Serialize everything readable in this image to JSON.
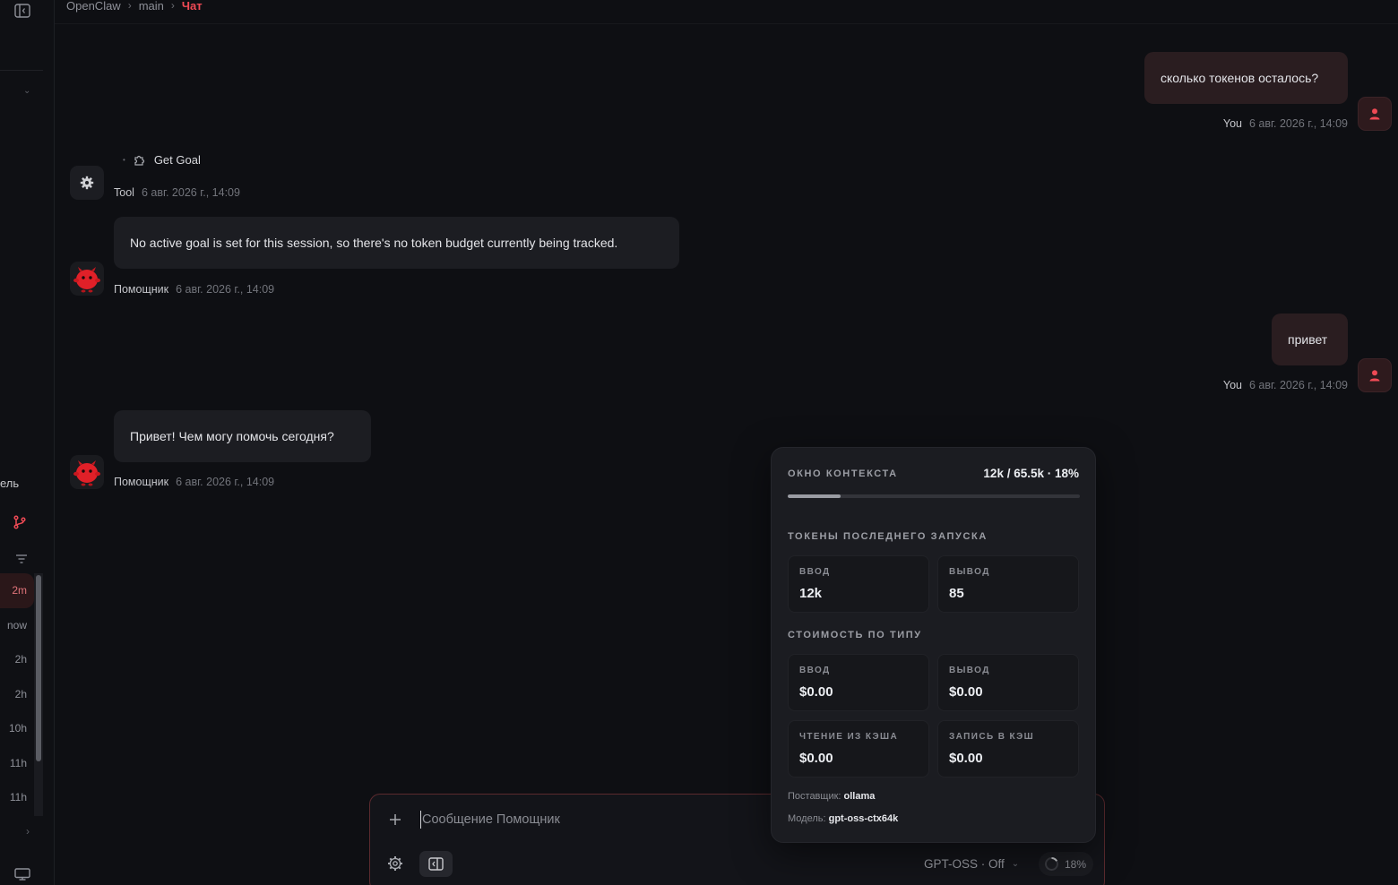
{
  "breadcrumb": {
    "items": [
      "OpenClaw",
      "main"
    ],
    "current": "Чат"
  },
  "rail": {
    "cut_label": "ель",
    "session_times": [
      "2m",
      "now",
      "2h",
      "2h",
      "10h",
      "11h",
      "11h"
    ]
  },
  "messages": {
    "user1": {
      "text": "сколько токенов осталось?",
      "author": "You",
      "time": "6 авг. 2026 г., 14:09"
    },
    "tool": {
      "call": "Get Goal",
      "author": "Tool",
      "time": "6 авг. 2026 г., 14:09"
    },
    "bot1": {
      "text": "No active goal is set for this session, so there's no token budget currently being tracked.",
      "author": "Помощник",
      "time": "6 авг. 2026 г., 14:09"
    },
    "user2": {
      "text": "привет",
      "author": "You",
      "time": "6 авг. 2026 г., 14:09"
    },
    "bot2": {
      "text": "Привет! Чем могу помочь сегодня?",
      "author": "Помощник",
      "time": "6 авг. 2026 г., 14:09"
    }
  },
  "composer": {
    "placeholder": "Сообщение Помощник",
    "model_label": "GPT-OSS · Off",
    "context_percent": "18%"
  },
  "context_popover": {
    "window_title": "ОКНО КОНТЕКСТА",
    "window_value": "12k / 65.5k · 18%",
    "window_fill": 0.18,
    "last_run_title": "ТОКЕНЫ ПОСЛЕДНЕГО ЗАПУСКА",
    "input_label": "ВВОД",
    "input_tokens": "12k",
    "output_label": "ВЫВОД",
    "output_tokens": "85",
    "cost_title": "СТОИМОСТЬ ПО ТИПУ",
    "cost_input": "$0.00",
    "cost_output": "$0.00",
    "cache_read_label": "ЧТЕНИЕ ИЗ КЭША",
    "cache_read": "$0.00",
    "cache_write_label": "ЗАПИСЬ В КЭШ",
    "cache_write": "$0.00",
    "provider_label": "Поставщик:",
    "provider": "ollama",
    "model_label": "Модель:",
    "model": "gpt-oss-ctx64k"
  },
  "colors": {
    "accent": "#ef4a55",
    "background": "#0e0f13",
    "bubble": "#1c1d22",
    "user_bubble": "#2a1d20"
  }
}
